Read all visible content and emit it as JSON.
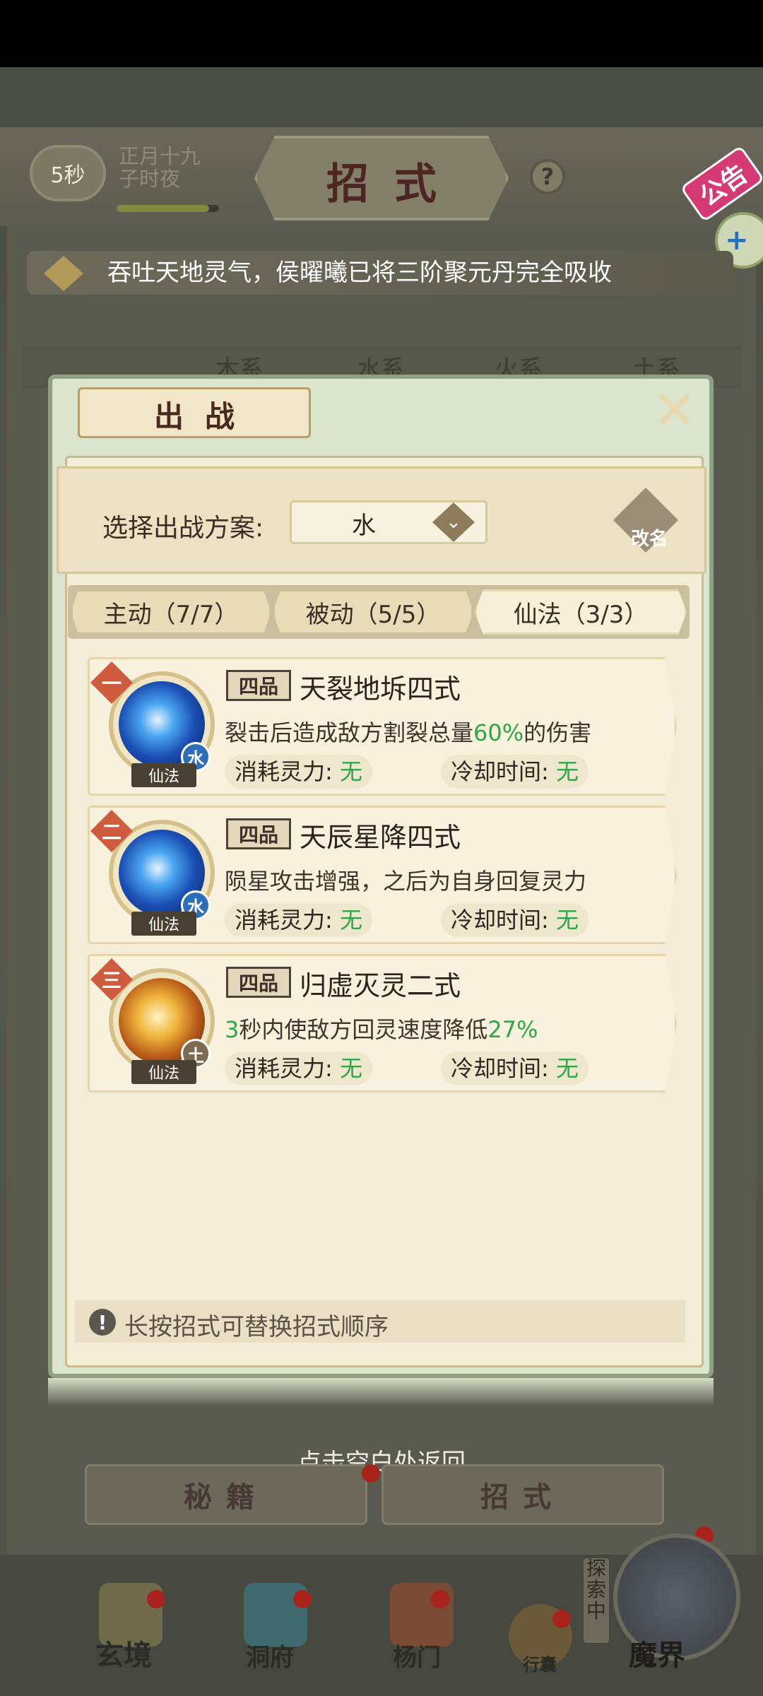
{
  "header": {
    "timer": "5秒",
    "date_line1": "正月十九",
    "date_line2": "子时夜",
    "timer_progress": 0.9,
    "title": "招式",
    "help": "?"
  },
  "notice_badge": "公告",
  "side_plus": "+",
  "announcement": "吞吐天地灵气，侯曜曦已将三阶聚元丹完全吸收",
  "element_tabs": [
    "木系",
    "水系",
    "火系",
    "土系"
  ],
  "modal": {
    "title": "出战",
    "close": "✕",
    "plan_label": "选择出战方案:",
    "plan_value": "水",
    "rename_label": "改名",
    "sub_tabs": [
      "主动（7/7）",
      "被动（5/5）",
      "仙法（3/3）"
    ],
    "active_sub_tab": 2,
    "skills": [
      {
        "order": "一",
        "grade": "四品",
        "name": "天裂地坼四式",
        "desc_pre": "裂击后造成敌方割裂总量",
        "desc_hl": "60%",
        "desc_post": "的伤害",
        "element": "水",
        "type": "仙法",
        "cost_label": "消耗灵力:",
        "cost_value": "无",
        "cd_label": "冷却时间:",
        "cd_value": "无"
      },
      {
        "order": "二",
        "grade": "四品",
        "name": "天辰星降四式",
        "desc_pre": "陨星攻击增强，之后为自身回复灵力",
        "desc_hl": "",
        "desc_post": "",
        "element": "水",
        "type": "仙法",
        "cost_label": "消耗灵力:",
        "cost_value": "无",
        "cd_label": "冷却时间:",
        "cd_value": "无"
      },
      {
        "order": "三",
        "grade": "四品",
        "name": "归虚灭灵二式",
        "desc_hl0": "3",
        "desc_pre": "秒内使敌方回灵速度降低",
        "desc_hl": "27%",
        "desc_post": "",
        "element": "土",
        "type": "仙法",
        "cost_label": "消耗灵力:",
        "cost_value": "无",
        "cd_label": "冷却时间:",
        "cd_value": "无"
      }
    ],
    "tip_icon": "!",
    "tip": "长按招式可替换招式顺序"
  },
  "return_hint": "点击空白处返回",
  "bottom_tabs": [
    "秘籍",
    "招式"
  ],
  "nav": {
    "items": [
      "玄境",
      "洞府",
      "杨门",
      "行囊",
      "魔界"
    ],
    "explore_badge": "探索中"
  },
  "colors": {
    "highlight_green": "#2fa64a",
    "order_badge": "#cf5c3e",
    "water": "#2e6db7",
    "notice_pink": "#d53a74"
  }
}
